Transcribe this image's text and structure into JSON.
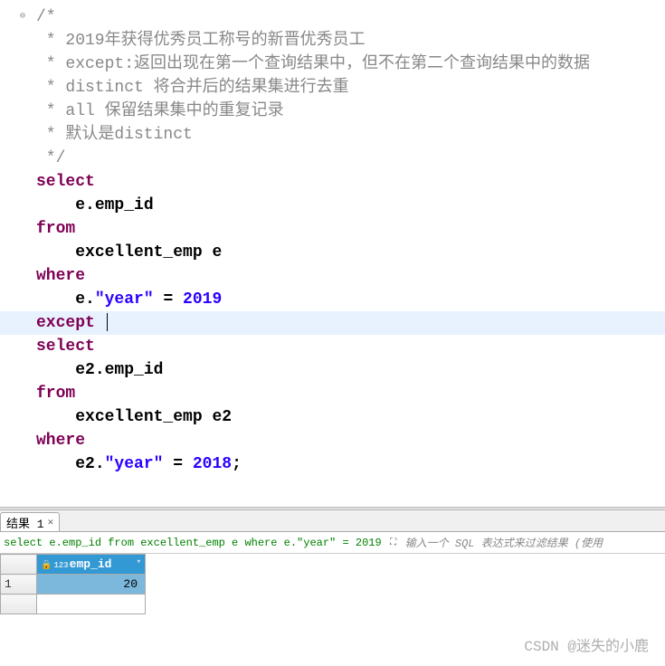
{
  "code": {
    "comments": {
      "open": "/*",
      "l1": " * 2019年获得优秀员工称号的新晋优秀员工",
      "l2": " * except:返回出现在第一个查询结果中，但不在第二个查询结果中的数据",
      "l3": " * distinct 将合并后的结果集进行去重",
      "l4": " * all 保留结果集中的重复记录",
      "l5": " * 默认是distinct",
      "close": " */"
    },
    "kw": {
      "select": "select",
      "from": "from",
      "where": "where",
      "except": "except"
    },
    "tok": {
      "e_emp_id": "e.emp_id",
      "excellent_emp_e": "excellent_emp e",
      "e_dot": "e.",
      "year_str": "\"year\"",
      "eq": " = ",
      "n2019": "2019",
      "e2_emp_id": "e2.emp_id",
      "excellent_emp_e2": "excellent_emp e2",
      "e2_dot": "e2.",
      "n2018": "2018",
      "semi": ";"
    }
  },
  "results": {
    "tab_label": "结果 1",
    "query_summary": "select e.emp_id from excellent_emp e where e.\"year\" = 2019",
    "filter_placeholder": "输入一个 SQL 表达式来过滤结果 (使用",
    "column_type_prefix": "123",
    "column_name": "emp_id",
    "rows": [
      {
        "n": "1",
        "value": "20"
      }
    ]
  },
  "watermark": "CSDN @迷失的小鹿"
}
